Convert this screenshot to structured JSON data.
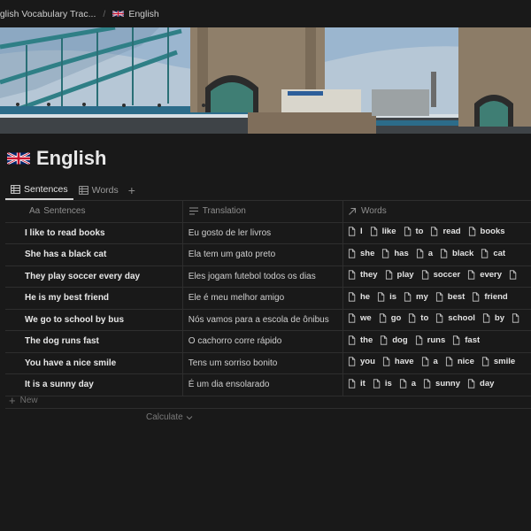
{
  "breadcrumb": {
    "workspace": "nglish Vocabulary Trac...",
    "separator": "/",
    "page": "English"
  },
  "page": {
    "title": "English"
  },
  "tabs": [
    {
      "label": "Sentences",
      "active": true
    },
    {
      "label": "Words",
      "active": false
    }
  ],
  "table": {
    "columns": [
      {
        "icon": "Aa",
        "label": "Sentences"
      },
      {
        "label": "Translation"
      },
      {
        "label": "Words"
      }
    ],
    "rows": [
      {
        "sentence": "I like to read books",
        "translation": "Eu gosto de ler livros",
        "words": [
          "I",
          "like",
          "to",
          "read",
          "books"
        ]
      },
      {
        "sentence": "She has a black cat",
        "translation": "Ela tem um gato preto",
        "words": [
          "she",
          "has",
          "a",
          "black",
          "cat"
        ]
      },
      {
        "sentence": "They play soccer every day",
        "translation": "Eles jogam futebol todos os dias",
        "words": [
          "they",
          "play",
          "soccer",
          "every",
          ""
        ]
      },
      {
        "sentence": "He is my best friend",
        "translation": "Ele é meu melhor amigo",
        "words": [
          "he",
          "is",
          "my",
          "best",
          "friend"
        ]
      },
      {
        "sentence": "We go to school by bus",
        "translation": "Nós vamos para a escola de ônibus",
        "words": [
          "we",
          "go",
          "to",
          "school",
          "by",
          ""
        ]
      },
      {
        "sentence": "The dog runs fast",
        "translation": "O cachorro corre rápido",
        "words": [
          "the",
          "dog",
          "runs",
          "fast"
        ]
      },
      {
        "sentence": "You have a nice smile",
        "translation": "Tens um sorriso bonito",
        "words": [
          "you",
          "have",
          "a",
          "nice",
          "smile"
        ]
      },
      {
        "sentence": "It is a sunny day",
        "translation": "É um dia ensolarado",
        "words": [
          "it",
          "is",
          "a",
          "sunny",
          "day"
        ]
      }
    ]
  },
  "new_row_label": "New",
  "calculate_label": "Calculate",
  "colors": {
    "background": "#191919",
    "text": "#d4d4d4",
    "muted": "#8f8f8f",
    "divider": "#2e2e2e"
  }
}
